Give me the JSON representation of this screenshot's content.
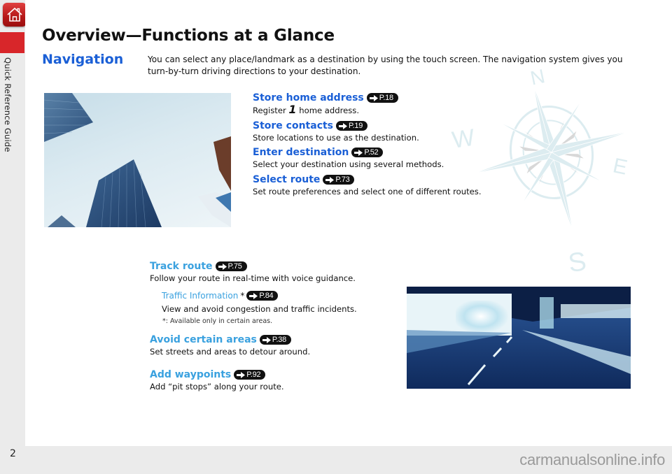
{
  "sidebar": {
    "home_icon": "home-icon",
    "label": "Quick Reference Guide"
  },
  "page": {
    "title": "Overview—Functions at a Glance",
    "section": "Navigation",
    "intro": "You can select any place/landmark as a destination by using the touch screen. The navigation system gives you turn-by-turn driving directions to your destination.",
    "page_number": "2",
    "watermark": "carmanualsonline.info"
  },
  "features": [
    {
      "title": "Store home address",
      "ref": "P.18",
      "desc_pre": "Register ",
      "desc_num": "1",
      "desc_post": " home address."
    },
    {
      "title": "Store contacts",
      "ref": "P.19",
      "desc": "Store locations to use as the destination."
    },
    {
      "title": "Enter destination",
      "ref": "P.52",
      "desc": "Select your destination using several methods."
    },
    {
      "title": "Select route",
      "ref": "P.73",
      "desc": "Set route preferences and select one of different routes."
    },
    {
      "title": "Track route",
      "ref": "P.75",
      "desc": "Follow your route in real-time with voice guidance."
    },
    {
      "title": "Avoid certain areas",
      "ref": "P.38",
      "desc": "Set streets and areas to detour around."
    },
    {
      "title": "Add waypoints",
      "ref": "P.92",
      "desc": "Add “pit stops” along your route."
    }
  ],
  "sub_feature": {
    "title": "Traffic Information",
    "asterisk": "*",
    "ref": "P.84",
    "desc": "View and avoid congestion and traffic incidents."
  },
  "footnote": "*: Available only in certain areas.",
  "compass": {
    "n": "N",
    "s": "S",
    "e": "E",
    "w": "W"
  },
  "colors": {
    "heading_blue": "#1a5fd6",
    "light_blue": "#3aa1df",
    "tab_red": "#d8262a",
    "compass_tint": "#dcecf0"
  }
}
